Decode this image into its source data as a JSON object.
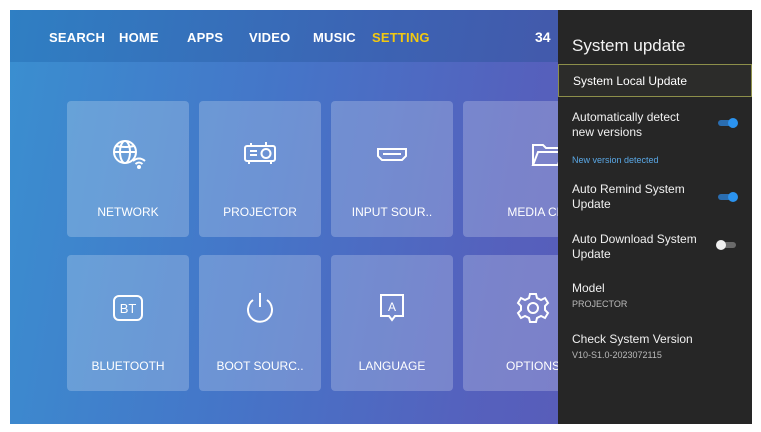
{
  "nav": {
    "items": [
      {
        "label": "SEARCH",
        "active": false
      },
      {
        "label": "HOME",
        "active": false
      },
      {
        "label": "APPS",
        "active": false
      },
      {
        "label": "VIDEO",
        "active": false
      },
      {
        "label": "MUSIC",
        "active": false
      },
      {
        "label": "SETTING",
        "active": true
      }
    ],
    "clock": "34"
  },
  "tiles": [
    {
      "label": "NETWORK",
      "icon": "network-globe-wifi-icon"
    },
    {
      "label": "PROJECTOR",
      "icon": "projector-icon"
    },
    {
      "label": "INPUT SOUR..",
      "icon": "hdmi-input-icon"
    },
    {
      "label": "MEDIA CENT",
      "icon": "media-folder-icon"
    },
    {
      "label": "BLUETOOTH",
      "icon": "bluetooth-bt-icon"
    },
    {
      "label": "BOOT SOURC..",
      "icon": "power-icon"
    },
    {
      "label": "LANGUAGE",
      "icon": "language-a-icon"
    },
    {
      "label": "OPTIONS",
      "icon": "gear-icon"
    }
  ],
  "panel": {
    "title": "System update",
    "selected": "System Local Update",
    "auto_detect": {
      "label": "Automatically detect new versions",
      "on": true
    },
    "note": "New version detected",
    "auto_remind": {
      "label": "Auto Remind System Update",
      "on": true
    },
    "auto_download": {
      "label": "Auto Download System Update",
      "on": false
    },
    "model": {
      "label": "Model",
      "value": "PROJECTOR"
    },
    "version": {
      "label": "Check System Version",
      "value": "V10-S1.0-2023072115"
    }
  },
  "colors": {
    "accent_active_nav": "#f2c811",
    "toggle_on": "#2b93ef",
    "panel_bg": "#262626",
    "note_text": "#5aa8e6"
  }
}
